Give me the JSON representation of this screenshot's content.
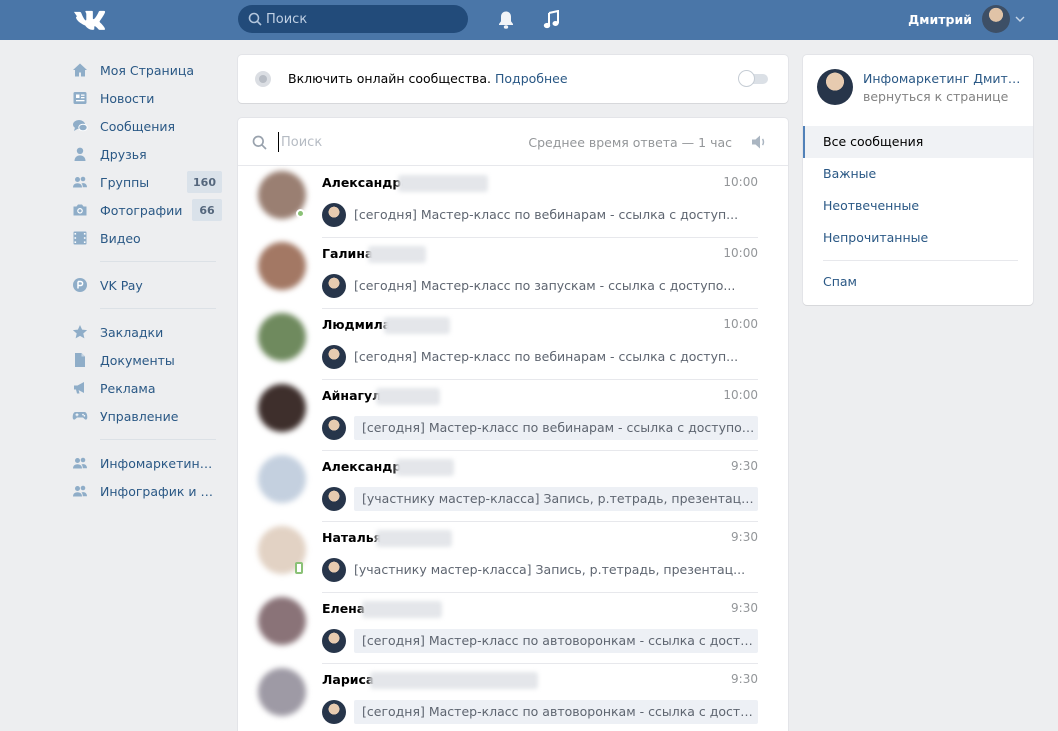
{
  "header": {
    "search_placeholder": "Поиск",
    "user_name": "Дмитрий"
  },
  "leftnav": {
    "items": [
      {
        "label": "Моя Страница",
        "icon": "home-icon"
      },
      {
        "label": "Новости",
        "icon": "news-icon"
      },
      {
        "label": "Сообщения",
        "icon": "messages-icon"
      },
      {
        "label": "Друзья",
        "icon": "friends-icon"
      },
      {
        "label": "Группы",
        "icon": "groups-icon",
        "badge": "160"
      },
      {
        "label": "Фотографии",
        "icon": "camera-icon",
        "badge": "66"
      },
      {
        "label": "Видео",
        "icon": "video-icon"
      },
      {
        "label": "VK Pay",
        "icon": "vkpay-icon"
      },
      {
        "label": "Закладки",
        "icon": "star-icon"
      },
      {
        "label": "Документы",
        "icon": "document-icon"
      },
      {
        "label": "Реклама",
        "icon": "megaphone-icon"
      },
      {
        "label": "Управление",
        "icon": "gamepad-icon"
      },
      {
        "label": "Инфомаркетинг Д...",
        "icon": "community-icon"
      },
      {
        "label": "Инфографик и ко...",
        "icon": "community-icon"
      }
    ]
  },
  "online": {
    "text": "Включить онлайн сообщества.",
    "link": "Подробнее"
  },
  "messages": {
    "search_placeholder": "Поиск",
    "response_time": "Среднее время ответа — 1 час",
    "dialogs": [
      {
        "name": "Александра",
        "time": "10:00",
        "text": "[сегодня] Мастер-класс по вебинарам - ссылка с доступ...",
        "unread": false,
        "status": "online",
        "avatar_color": "#9a7f72"
      },
      {
        "name": "Галина",
        "time": "10:00",
        "text": "[сегодня] Мастер-класс по запускам - ссылка с доступо...",
        "unread": false,
        "status": "",
        "avatar_color": "#a37864"
      },
      {
        "name": "Людмила",
        "time": "10:00",
        "text": "[сегодня] Мастер-класс по вебинарам - ссылка с доступ...",
        "unread": false,
        "status": "",
        "avatar_color": "#6f8a5e"
      },
      {
        "name": "Айнагул",
        "time": "10:00",
        "text": "[сегодня] Мастер-класс по вебинарам - ссылка с доступом При...",
        "unread": true,
        "status": "",
        "avatar_color": "#3e2f2c"
      },
      {
        "name": "Александр",
        "time": "9:30",
        "text": "[участнику мастер-класса] Запись, р.тетрадь, презентация и сп...",
        "unread": true,
        "status": "",
        "avatar_color": "#c4d0df"
      },
      {
        "name": "Наталья",
        "time": "9:30",
        "text": "[участнику мастер-класса] Запись, р.тетрадь, презентац...",
        "unread": false,
        "status": "mobile",
        "avatar_color": "#e2d2c4"
      },
      {
        "name": "Елена",
        "time": "9:30",
        "text": "[сегодня] Мастер-класс по автоворонкам - ссылка с доступом ...",
        "unread": true,
        "status": "",
        "avatar_color": "#8a7378"
      },
      {
        "name": "Лариса",
        "time": "9:30",
        "text": "[сегодня] Мастер-класс по автоворонкам - ссылка с доступом ...",
        "unread": true,
        "status": "",
        "avatar_color": "#9e9aa5"
      }
    ]
  },
  "right_panel": {
    "title": "Инфомаркетинг Дмитрий",
    "subtitle": "вернуться к странице",
    "filters": [
      "Все сообщения",
      "Важные",
      "Неотвеченные",
      "Непрочитанные"
    ],
    "spam": "Спам"
  },
  "colors": {
    "header": "#4a76a8",
    "link": "#2a5885",
    "background": "#edeef0",
    "online": "#8ac176"
  }
}
